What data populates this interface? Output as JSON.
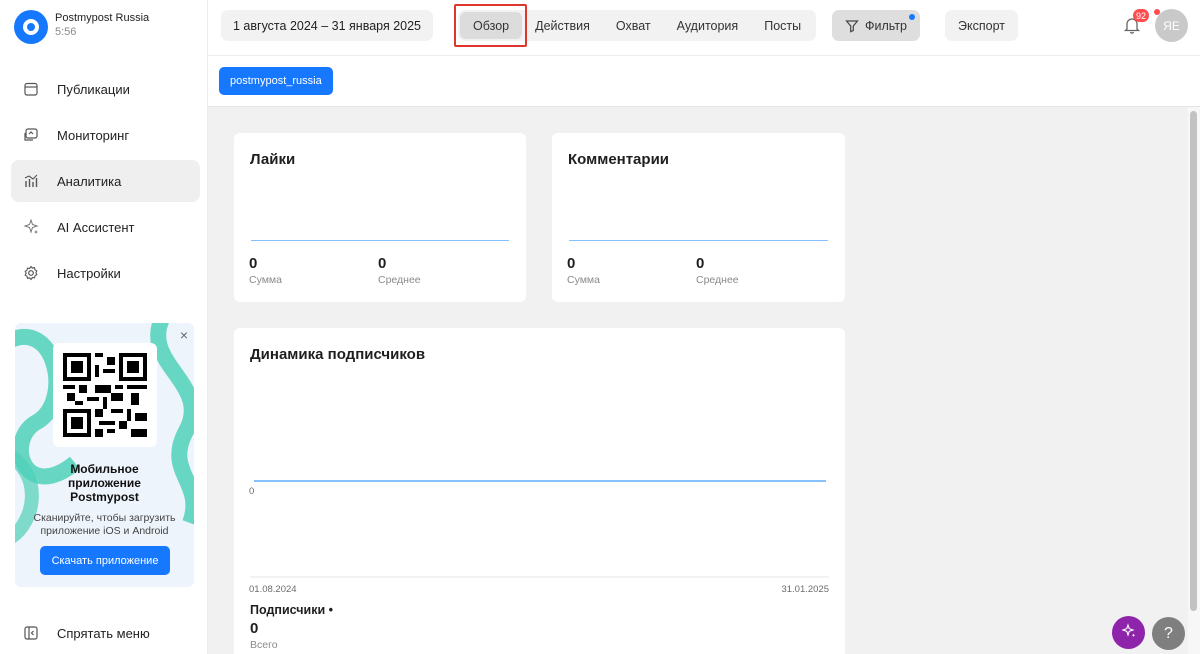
{
  "account": {
    "name": "Postmypost Russia",
    "time": "5:56"
  },
  "sidebar": {
    "items": [
      {
        "label": "Публикации",
        "icon": "calendar-icon",
        "active": false
      },
      {
        "label": "Мониторинг",
        "icon": "monitoring-icon",
        "active": false
      },
      {
        "label": "Аналитика",
        "icon": "analytics-icon",
        "active": true
      },
      {
        "label": "AI Ассистент",
        "icon": "sparkle-icon",
        "active": false
      },
      {
        "label": "Настройки",
        "icon": "gear-icon",
        "active": false
      }
    ],
    "hide_menu_label": "Спрятать меню"
  },
  "promo": {
    "close_label": "×",
    "title_line1": "Мобильное",
    "title_line2": "приложение",
    "title_line3": "Postmypost",
    "subtitle": "Сканируйте, чтобы загрузить приложение iOS и Android",
    "button_label": "Скачать приложение"
  },
  "topbar": {
    "date_range": "1 августа 2024 – 31 января 2025",
    "tabs": [
      {
        "label": "Обзор",
        "active": true
      },
      {
        "label": "Действия",
        "active": false
      },
      {
        "label": "Охват",
        "active": false
      },
      {
        "label": "Аудитория",
        "active": false
      },
      {
        "label": "Посты",
        "active": false
      }
    ],
    "filter_label": "Фильтр",
    "export_label": "Экспорт",
    "notifications_count": "92",
    "avatar_initials": "ЯЕ"
  },
  "account_chip": "postmypost_russia",
  "cards": {
    "likes": {
      "title": "Лайки",
      "sum_value": "0",
      "sum_label": "Сумма",
      "avg_value": "0",
      "avg_label": "Среднее"
    },
    "comments": {
      "title": "Комментарии",
      "sum_value": "0",
      "sum_label": "Сумма",
      "avg_value": "0",
      "avg_label": "Среднее"
    }
  },
  "chart_data": {
    "type": "line",
    "title": "Динамика подписчиков",
    "x": [
      "01.08.2024",
      "31.01.2025"
    ],
    "series": [
      {
        "name": "Подписчики",
        "values": [
          0,
          0
        ]
      }
    ],
    "y_tick_labels": [
      "0"
    ],
    "xlabel": "",
    "ylabel": ""
  },
  "subscribers": {
    "legend": "Подписчики •",
    "value": "0",
    "label": "Всего"
  },
  "colors": {
    "accent": "#1677ff",
    "highlight": "#e0352b",
    "ai_button": "#8e24aa",
    "line": "#86c1ff"
  }
}
